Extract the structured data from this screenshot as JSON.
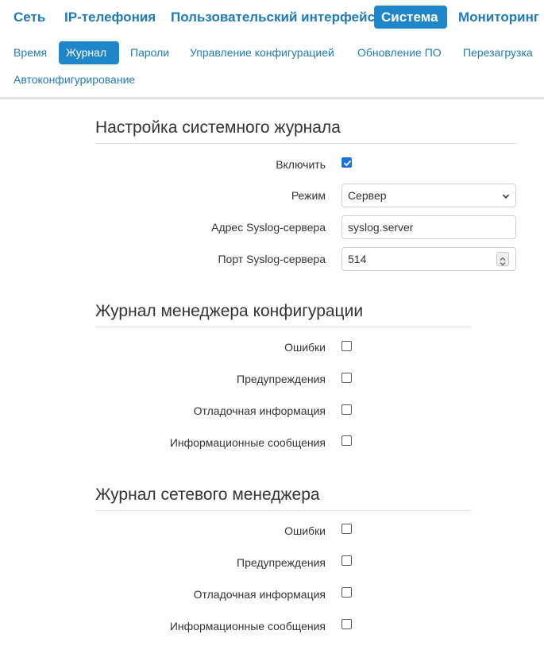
{
  "nav": {
    "top": [
      "Сеть",
      "IP-телефония",
      "Пользовательский интерфейс",
      "Система",
      "Мониторинг"
    ],
    "top_active": "Система",
    "sub": [
      "Время",
      "Журнал",
      "Пароли",
      "Управление конфигурацией",
      "Обновление ПО",
      "Перезагрузка",
      "Автоконфигурирование"
    ],
    "sub_active": "Журнал"
  },
  "syslog": {
    "title": "Настройка системного журнала",
    "enable_label": "Включить",
    "enabled": true,
    "mode_label": "Режим",
    "mode_value": "Сервер",
    "address_label": "Адрес Syslog-сервера",
    "address_value": "syslog.server",
    "port_label": "Порт Syslog-сервера",
    "port_value": "514"
  },
  "config_log": {
    "title": "Журнал менеджера конфигурации",
    "items": [
      {
        "label": "Ошибки",
        "checked": false
      },
      {
        "label": "Предупреждения",
        "checked": false
      },
      {
        "label": "Отладочная информация",
        "checked": false
      },
      {
        "label": "Информационные сообщения",
        "checked": false
      }
    ]
  },
  "network_log": {
    "title": "Журнал сетевого менеджера",
    "items": [
      {
        "label": "Ошибки",
        "checked": false
      },
      {
        "label": "Предупреждения",
        "checked": false
      },
      {
        "label": "Отладочная информация",
        "checked": false
      },
      {
        "label": "Информационные сообщения",
        "checked": false
      }
    ]
  },
  "colors": {
    "accent": "#1f86c9",
    "link": "#1f7ab8",
    "checkbox_checked": "#1a73d9"
  }
}
